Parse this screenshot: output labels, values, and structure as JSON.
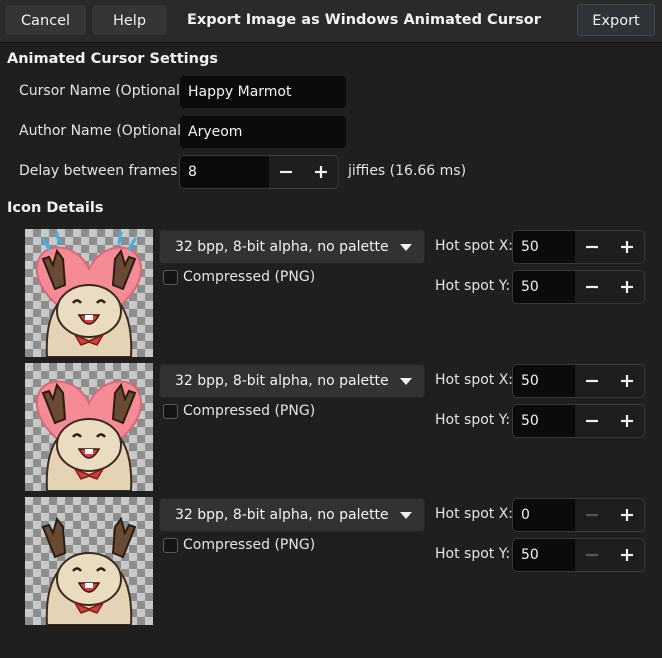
{
  "header": {
    "cancel_label": "Cancel",
    "help_label": "Help",
    "title": "Export Image as Windows Animated Cursor",
    "export_label": "Export"
  },
  "settings": {
    "section_title": "Animated Cursor Settings",
    "cursor_name_label": "Cursor Name (Optional)",
    "cursor_name_value": "Happy Marmot",
    "author_name_label": "Author Name (Optional)",
    "author_name_value": "Aryeom",
    "delay_label": "Delay between frames:",
    "delay_value": "8",
    "delay_unit": "jiffies (16.66 ms)"
  },
  "icons": {
    "section_title": "Icon Details",
    "compressed_label": "Compressed (PNG)",
    "hotspot_x_label": "Hot spot X:",
    "hotspot_y_label": "Hot spot Y:",
    "frames": [
      {
        "format": "32 bpp, 8-bit alpha, no palette",
        "compressed": false,
        "hotspot_x": "50",
        "hotspot_y": "50"
      },
      {
        "format": "32 bpp, 8-bit alpha, no palette",
        "compressed": false,
        "hotspot_x": "50",
        "hotspot_y": "50"
      },
      {
        "format": "32 bpp, 8-bit alpha, no palette",
        "compressed": false,
        "hotspot_x": "0",
        "hotspot_y": "50"
      }
    ]
  },
  "colors": {
    "background": "#1f1f1f",
    "entry_background": "#0b0b0b",
    "button_background": "#353535",
    "text": "#e8e8e8",
    "disabled_icon": "#555555"
  }
}
